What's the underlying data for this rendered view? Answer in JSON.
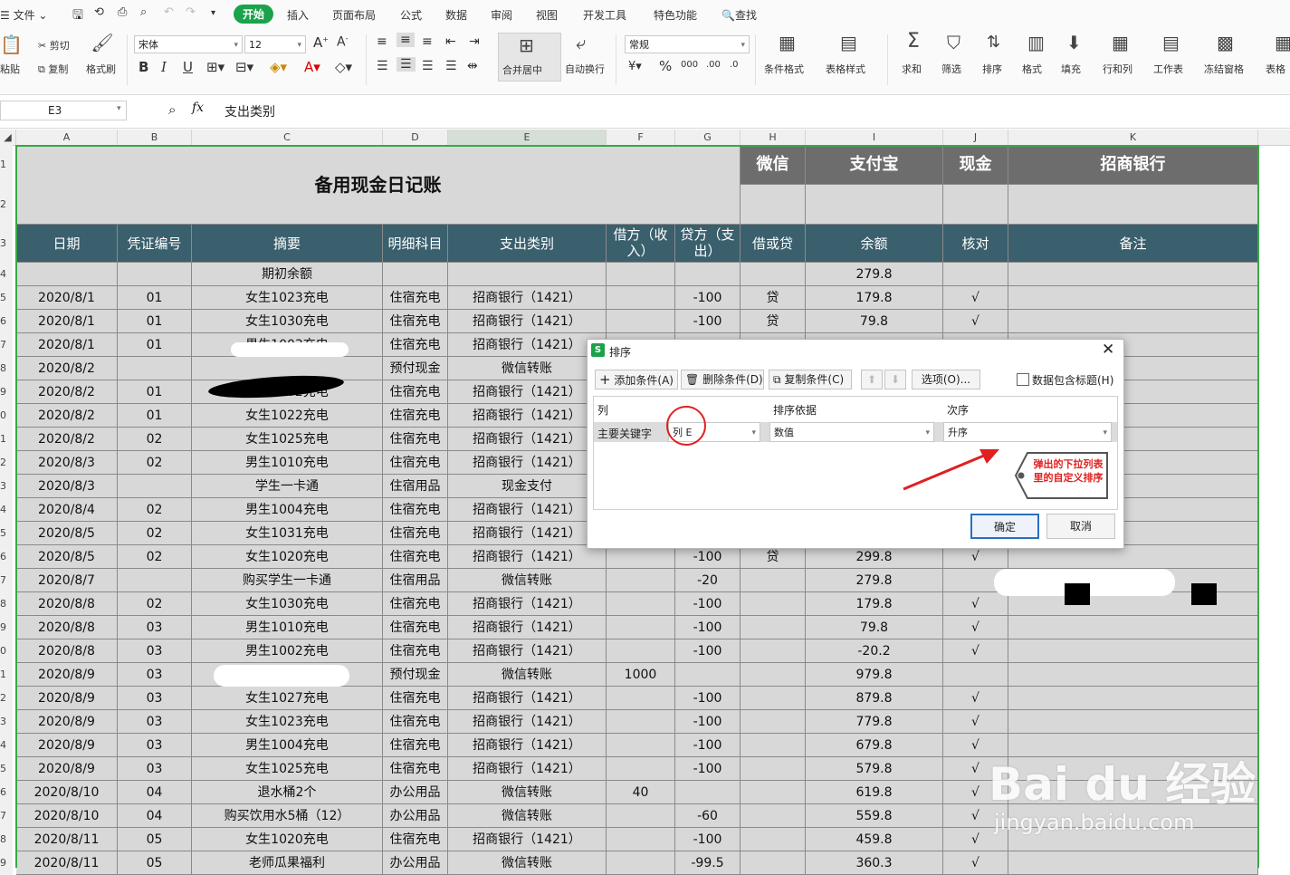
{
  "menu": {
    "file": "文件",
    "tabs": [
      "开始",
      "插入",
      "页面布局",
      "公式",
      "数据",
      "审阅",
      "视图",
      "开发工具",
      "特色功能"
    ],
    "search": "查找"
  },
  "ribbon": {
    "paste": "粘贴",
    "cut": "剪切",
    "copy": "复制",
    "format_painter": "格式刷",
    "font_name": "宋体",
    "font_size": "12",
    "bold": "B",
    "italic": "I",
    "underline": "U",
    "merge_center": "合并居中",
    "wrap_text": "自动换行",
    "number_format": "常规",
    "percent": "%",
    "conditional_format": "条件格式",
    "table_style": "表格样式",
    "sum": "求和",
    "filter": "筛选",
    "sort": "排序",
    "format": "格式",
    "fill": "填充",
    "row_col": "行和列",
    "worksheet": "工作表",
    "freeze": "冻结窗格",
    "table_tools": "表格"
  },
  "formula_bar": {
    "cell_ref": "E3",
    "fx": "fx",
    "content": "支出类别"
  },
  "sheet": {
    "columns": [
      "A",
      "B",
      "C",
      "D",
      "E",
      "F",
      "G",
      "H",
      "I",
      "J",
      "K"
    ],
    "title": "备用现金日记账",
    "account_headers": [
      "微信",
      "支付宝",
      "现金",
      "招商银行"
    ],
    "headers": [
      "日期",
      "凭证编号",
      "摘要",
      "明细科目",
      "支出类别",
      "借方（收入）",
      "贷方（支出）",
      "借或贷",
      "余额",
      "核对",
      "备注"
    ],
    "rows": [
      [
        "",
        "",
        "期初余额",
        "",
        "",
        "",
        "",
        "",
        "279.8",
        "",
        ""
      ],
      [
        "2020/8/1",
        "01",
        "女生1023充电",
        "住宿充电",
        "招商银行（1421）",
        "",
        "-100",
        "贷",
        "179.8",
        "√",
        ""
      ],
      [
        "2020/8/1",
        "01",
        "女生1030充电",
        "住宿充电",
        "招商银行（1421）",
        "",
        "-100",
        "贷",
        "79.8",
        "√",
        ""
      ],
      [
        "2020/8/1",
        "01",
        "男生1003充电",
        "住宿充电",
        "招商银行（1421）",
        "",
        "",
        "",
        "",
        "",
        ""
      ],
      [
        "2020/8/2",
        "",
        "",
        "预付现金",
        "微信转账",
        "",
        "",
        "",
        "",
        "",
        ""
      ],
      [
        "2020/8/2",
        "01",
        "男生1002充电",
        "住宿充电",
        "招商银行（1421）",
        "",
        "",
        "",
        "",
        "",
        ""
      ],
      [
        "2020/8/2",
        "01",
        "女生1022充电",
        "住宿充电",
        "招商银行（1421）",
        "",
        "",
        "",
        "",
        "",
        ""
      ],
      [
        "2020/8/2",
        "02",
        "女生1025充电",
        "住宿充电",
        "招商银行（1421）",
        "",
        "",
        "",
        "",
        "",
        ""
      ],
      [
        "2020/8/3",
        "02",
        "男生1010充电",
        "住宿充电",
        "招商银行（1421）",
        "",
        "",
        "",
        "",
        "",
        ""
      ],
      [
        "2020/8/3",
        "",
        "学生一卡通",
        "住宿用品",
        "现金支付",
        "",
        "",
        "",
        "",
        "",
        ""
      ],
      [
        "2020/8/4",
        "02",
        "男生1004充电",
        "住宿充电",
        "招商银行（1421）",
        "",
        "",
        "",
        "",
        "",
        ""
      ],
      [
        "2020/8/5",
        "02",
        "女生1031充电",
        "住宿充电",
        "招商银行（1421）",
        "",
        "",
        "",
        "",
        "",
        ""
      ],
      [
        "2020/8/5",
        "02",
        "女生1020充电",
        "住宿充电",
        "招商银行（1421）",
        "",
        "-100",
        "贷",
        "299.8",
        "√",
        ""
      ],
      [
        "2020/8/7",
        "",
        "购买学生一卡通",
        "住宿用品",
        "微信转账",
        "",
        "-20",
        "",
        "279.8",
        "",
        ""
      ],
      [
        "2020/8/8",
        "02",
        "女生1030充电",
        "住宿充电",
        "招商银行（1421）",
        "",
        "-100",
        "",
        "179.8",
        "√",
        ""
      ],
      [
        "2020/8/8",
        "03",
        "男生1010充电",
        "住宿充电",
        "招商银行（1421）",
        "",
        "-100",
        "",
        "79.8",
        "√",
        ""
      ],
      [
        "2020/8/8",
        "03",
        "男生1002充电",
        "住宿充电",
        "招商银行（1421）",
        "",
        "-100",
        "",
        "-20.2",
        "√",
        ""
      ],
      [
        "2020/8/9",
        "03",
        "",
        "预付现金",
        "微信转账",
        "1000",
        "",
        "",
        "979.8",
        "",
        ""
      ],
      [
        "2020/8/9",
        "03",
        "女生1027充电",
        "住宿充电",
        "招商银行（1421）",
        "",
        "-100",
        "",
        "879.8",
        "√",
        ""
      ],
      [
        "2020/8/9",
        "03",
        "女生1023充电",
        "住宿充电",
        "招商银行（1421）",
        "",
        "-100",
        "",
        "779.8",
        "√",
        ""
      ],
      [
        "2020/8/9",
        "03",
        "男生1004充电",
        "住宿充电",
        "招商银行（1421）",
        "",
        "-100",
        "",
        "679.8",
        "√",
        ""
      ],
      [
        "2020/8/9",
        "03",
        "女生1025充电",
        "住宿充电",
        "招商银行（1421）",
        "",
        "-100",
        "",
        "579.8",
        "√",
        ""
      ],
      [
        "2020/8/10",
        "04",
        "退水桶2个",
        "办公用品",
        "微信转账",
        "40",
        "",
        "",
        "619.8",
        "√",
        ""
      ],
      [
        "2020/8/10",
        "04",
        "购买饮用水5桶（12）",
        "办公用品",
        "微信转账",
        "",
        "-60",
        "",
        "559.8",
        "√",
        ""
      ],
      [
        "2020/8/11",
        "05",
        "女生1020充电",
        "住宿充电",
        "招商银行（1421）",
        "",
        "-100",
        "",
        "459.8",
        "√",
        ""
      ],
      [
        "2020/8/11",
        "05",
        "老师瓜果福利",
        "办公用品",
        "微信转账",
        "",
        "-99.5",
        "",
        "360.3",
        "√",
        ""
      ]
    ]
  },
  "sort_dialog": {
    "title": "排序",
    "add_condition": "添加条件(A)",
    "delete_condition": "删除条件(D)",
    "copy_condition": "复制条件(C)",
    "options": "选项(O)...",
    "header_checkbox": "数据包含标题(H)",
    "col_header_column": "列",
    "col_header_basis": "排序依据",
    "col_header_order": "次序",
    "primary_key_label": "主要关键字",
    "primary_key_value": "列 E",
    "basis_value": "数值",
    "order_value": "升序",
    "annotation": "弹出的下拉列表里的自定义排序",
    "ok": "确定",
    "cancel": "取消"
  },
  "watermark": {
    "brand": "Bai du 经验",
    "url": "jingyan.baidu.com"
  },
  "colors": {
    "accent_green": "#1aa34a",
    "header_teal": "#3a5f6d",
    "header_gray": "#6d6d6d",
    "cell_gray": "#d8d8d8",
    "annotation_red": "#e02020"
  }
}
